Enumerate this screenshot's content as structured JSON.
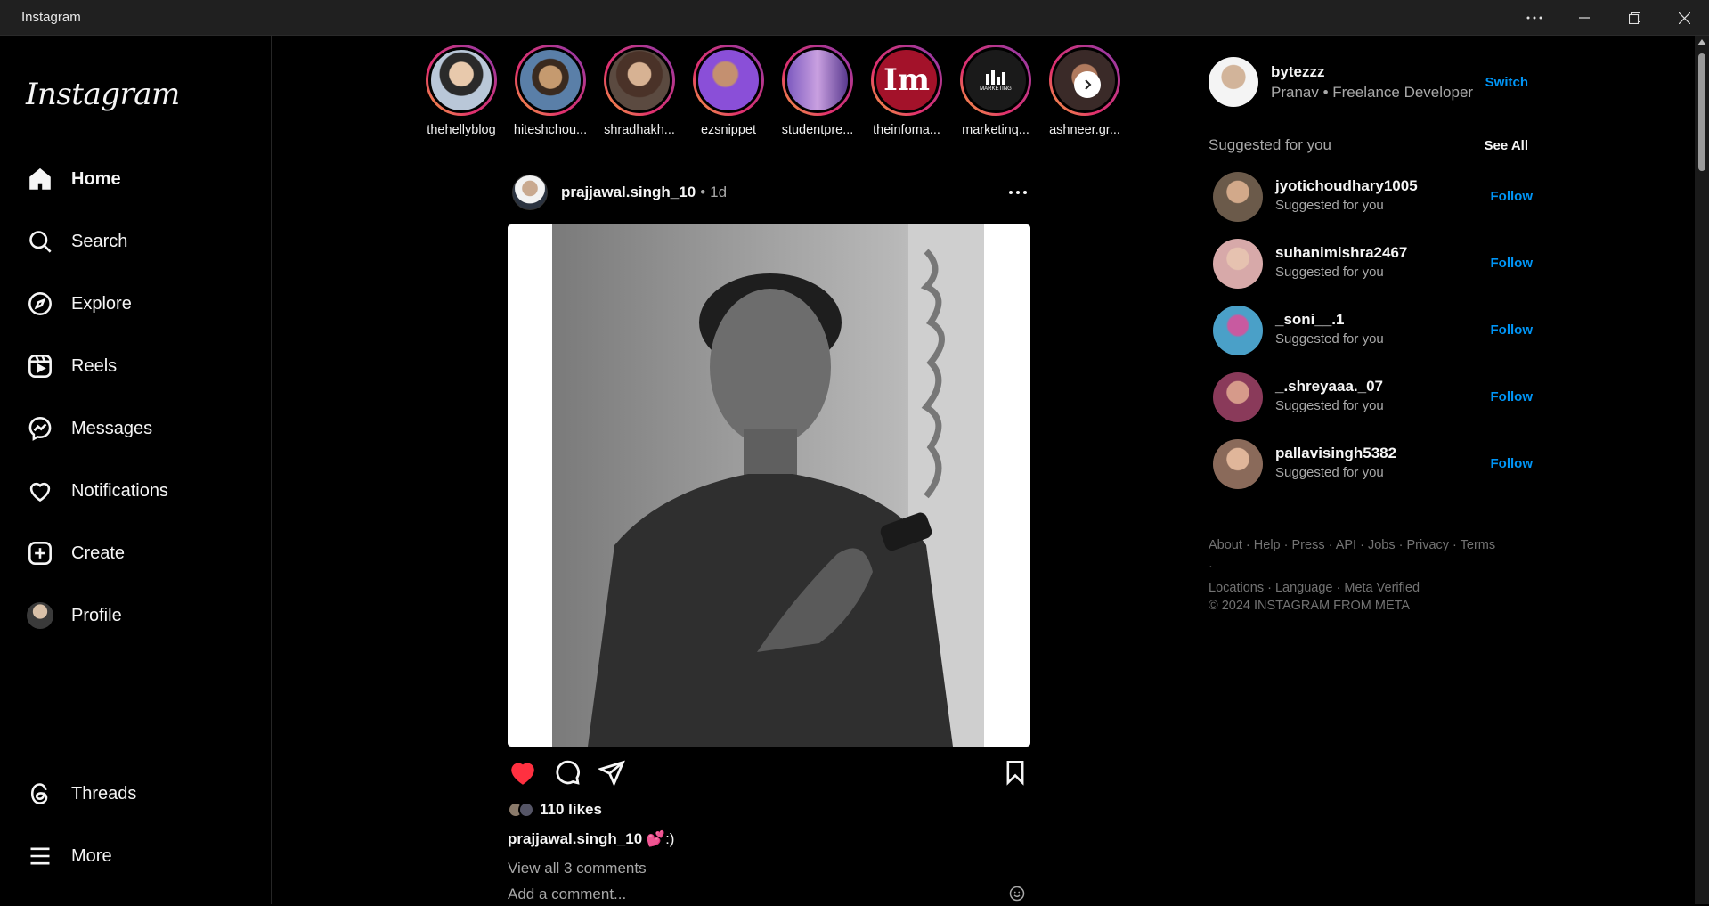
{
  "window": {
    "title": "Instagram",
    "controls": [
      "more-icon",
      "minimize-icon",
      "restore-icon",
      "close-icon"
    ]
  },
  "sidebar": {
    "logo": "Instagram",
    "items": [
      {
        "label": "Home",
        "icon": "home-icon",
        "active": true
      },
      {
        "label": "Search",
        "icon": "search-icon"
      },
      {
        "label": "Explore",
        "icon": "compass-icon"
      },
      {
        "label": "Reels",
        "icon": "reels-icon"
      },
      {
        "label": "Messages",
        "icon": "messenger-icon"
      },
      {
        "label": "Notifications",
        "icon": "heart-icon"
      },
      {
        "label": "Create",
        "icon": "plus-square-icon"
      },
      {
        "label": "Profile",
        "icon": "avatar"
      }
    ],
    "bottom": [
      {
        "label": "Threads",
        "icon": "threads-icon"
      },
      {
        "label": "More",
        "icon": "hamburger-icon"
      }
    ]
  },
  "stories": [
    {
      "username": "thehellyblog",
      "color": "#b9c7d8"
    },
    {
      "username": "hiteshchou...",
      "color": "#5a7fa8"
    },
    {
      "username": "shradhakh...",
      "color": "#5b4a40"
    },
    {
      "username": "ezsnippet",
      "color": "#6b3fd0"
    },
    {
      "username": "studentpre...",
      "color": "#7d5ac0"
    },
    {
      "username": "theinfoma...",
      "color": "#a3122a",
      "badge": "Im"
    },
    {
      "username": "marketinq...",
      "color": "#1a1a1a",
      "badge": "MARKETING"
    },
    {
      "username": "ashneer.gr...",
      "color": "#7a4a3a"
    }
  ],
  "post": {
    "username": "prajjawal.singh_10",
    "separator": "•",
    "time": "1d",
    "likes": "110 likes",
    "caption_user": "prajjawal.singh_10",
    "caption_text": "💕:)",
    "view_comments": "View all 3 comments",
    "add_comment_placeholder": "Add a comment...",
    "liked": true,
    "like_color": "#ff3040"
  },
  "right_panel": {
    "me": {
      "username": "bytezzz",
      "name": "Pranav • Freelance Developer",
      "switch_label": "Switch"
    },
    "suggested_heading": "Suggested for you",
    "see_all": "See All",
    "suggestions": [
      {
        "username": "jyotichoudhary1005",
        "subtitle": "Suggested for you",
        "action": "Follow",
        "color": "#6b5a4a"
      },
      {
        "username": "suhanimishra2467",
        "subtitle": "Suggested for you",
        "action": "Follow",
        "color": "#d7a9a9"
      },
      {
        "username": "_soni__.1",
        "subtitle": "Suggested for you",
        "action": "Follow",
        "color": "#4aa0c8"
      },
      {
        "username": "_.shreyaaa._07",
        "subtitle": "Suggested for you",
        "action": "Follow",
        "color": "#8a3a5a"
      },
      {
        "username": "pallavisingh5382",
        "subtitle": "Suggested for you",
        "action": "Follow",
        "color": "#8a6a5a"
      }
    ],
    "footer_links": [
      "About",
      "Help",
      "Press",
      "API",
      "Jobs",
      "Privacy",
      "Terms",
      "Locations",
      "Language",
      "Meta Verified"
    ],
    "copyright": "© 2024 INSTAGRAM FROM META"
  },
  "colors": {
    "accent": "#0095f6",
    "background": "#000000",
    "muted": "#a8a8a8"
  }
}
